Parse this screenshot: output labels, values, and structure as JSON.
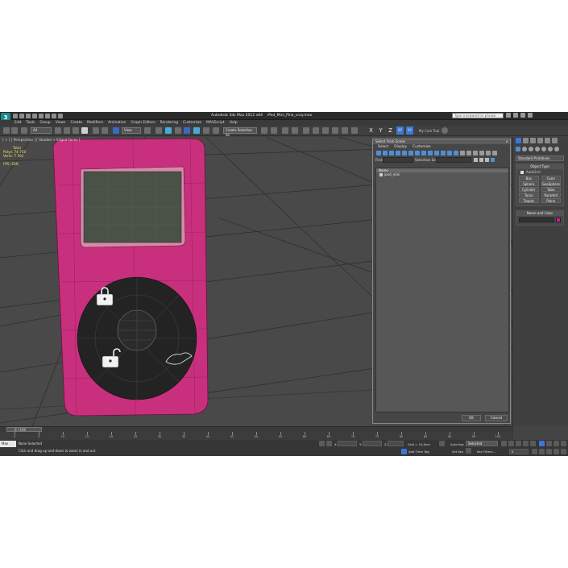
{
  "titlebar": {
    "app_name": "Autodesk 3ds Max  2012 x64",
    "file_name": "iPod_Mini_Pink_vray.max",
    "search_placeholder": "Type a keyword or phrase"
  },
  "menu": [
    "Edit",
    "Tools",
    "Group",
    "Views",
    "Create",
    "Modifiers",
    "Animation",
    "Graph Editors",
    "Rendering",
    "Customize",
    "MAXScript",
    "Help"
  ],
  "toolbar": {
    "selection_filter": "All",
    "reference_coord": "View",
    "named_selection": "Create Selection Se",
    "axis_x": "X",
    "axis_y": "Y",
    "axis_z": "Z",
    "axis_xy": "XY",
    "axis_xy2": "XY",
    "cam_tool": "My Cam Tool"
  },
  "viewport": {
    "label": "[ + ] [ Perspective ] [ Shaded + Edged Faces ]",
    "stats": {
      "total_label": "Total",
      "polys_label": "Polys:",
      "polys_value": "74 750",
      "verts_label": "Verts:",
      "verts_value": "7 391",
      "fps_label": "FPS:",
      "fps_value": "ERR"
    }
  },
  "select_dialog": {
    "title": "Select From Scene",
    "menu": [
      "Select",
      "Display",
      "Customize"
    ],
    "find_label": "Find:",
    "selection_set_label": "Selection Set:",
    "column_name": "Name",
    "objects": [
      "ipod_mini"
    ],
    "ok_label": "OK",
    "cancel_label": "Cancel"
  },
  "command_panel": {
    "category": "Standard Primitives",
    "object_type_header": "Object Type",
    "autogrid": "AutoGrid",
    "primitives": [
      "Box",
      "Cone",
      "Sphere",
      "GeoSphere",
      "Cylinder",
      "Tube",
      "Torus",
      "Pyramid",
      "Teapot",
      "Plane"
    ],
    "name_color_header": "Name and Color",
    "color": "#d21e8a"
  },
  "timeline": {
    "frame_label": "0 / 100",
    "ticks": [
      "0",
      "5",
      "10",
      "15",
      "20",
      "25",
      "30",
      "35",
      "40",
      "45",
      "50",
      "55",
      "60",
      "65",
      "70",
      "75",
      "80",
      "85",
      "90",
      "95",
      "100"
    ]
  },
  "status": {
    "maxscript_label": "Max",
    "line1": "None Selected",
    "line2": "Click and drag up-and-down to zoom in and out",
    "x_label": "X:",
    "y_label": "Y:",
    "z_label": "Z:",
    "grid_text": "Grid = 10,0cm",
    "auto_key": "Auto Key",
    "set_key": "Set Key",
    "selected_dd": "Selected",
    "key_filters": "Key Filters...",
    "add_time_tag": "Add Time Tag",
    "frame_field": "0"
  },
  "colors": {
    "ipod_body": "#c8307e",
    "accent": "#3c78d8"
  }
}
